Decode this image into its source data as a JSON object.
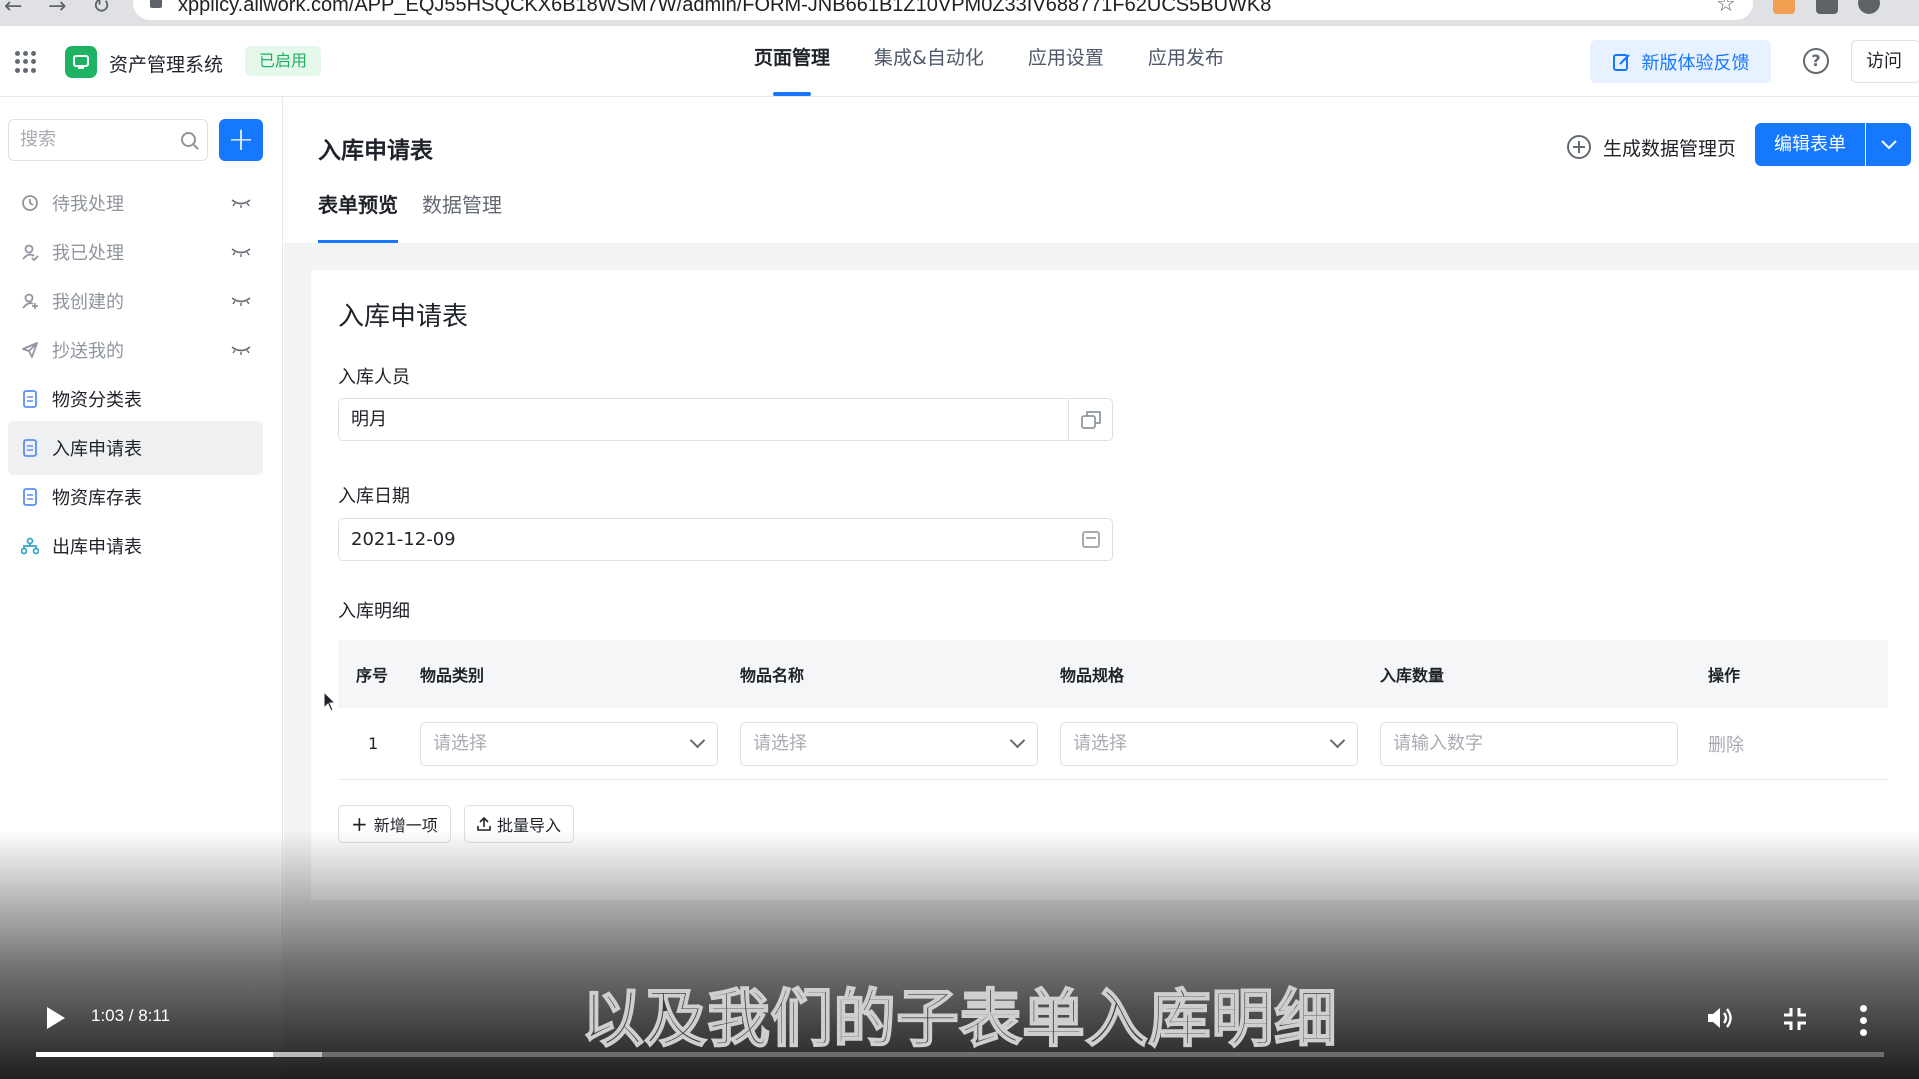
{
  "browser": {
    "url": "xpplicy.aliwork.com/APP_EQJ55HSQCKX6B18WSM7W/admin/FORM-JNB661B1Z10VPM0Z33IV688771F62UCS5BUWK8"
  },
  "header": {
    "app_name": "资产管理系统",
    "status_badge": "已启用",
    "tabs": [
      "页面管理",
      "集成&自动化",
      "应用设置",
      "应用发布"
    ],
    "active_tab": "页面管理",
    "feedback_label": "新版体验反馈",
    "help_glyph": "?",
    "visit_label": "访问"
  },
  "sidebar": {
    "search_placeholder": "搜索",
    "add_glyph": "+",
    "items": [
      {
        "label": "待我处理",
        "icon": "clock-icon",
        "hidden": true
      },
      {
        "label": "我已处理",
        "icon": "user-check-icon",
        "hidden": true
      },
      {
        "label": "我创建的",
        "icon": "user-add-icon",
        "hidden": true
      },
      {
        "label": "抄送我的",
        "icon": "send-icon",
        "hidden": true
      },
      {
        "label": "物资分类表",
        "icon": "document-icon"
      },
      {
        "label": "入库申请表",
        "icon": "document-icon",
        "active": true
      },
      {
        "label": "物资库存表",
        "icon": "document-icon"
      },
      {
        "label": "出库申请表",
        "icon": "flow-icon"
      }
    ]
  },
  "main": {
    "page_title": "入库申请表",
    "generate_label": "生成数据管理页",
    "edit_label": "编辑表单",
    "sub_tabs": [
      "表单预览",
      "数据管理"
    ],
    "active_sub_tab": "表单预览"
  },
  "form": {
    "title": "入库申请表",
    "fields": [
      {
        "label": "入库人员",
        "value": "明月"
      },
      {
        "label": "入库日期",
        "value": "2021-12-09"
      }
    ],
    "detail_label": "入库明细",
    "table": {
      "headers": [
        "序号",
        "物品类别",
        "物品名称",
        "物品规格",
        "入库数量",
        "操作"
      ],
      "rows": [
        {
          "seq": "1",
          "category": "请选择",
          "name": "请选择",
          "spec": "请选择",
          "quantity": "请输入数字",
          "action": "删除"
        }
      ]
    },
    "add_row_label": "新增一项",
    "batch_import_label": "批量导入"
  },
  "video": {
    "subtitle": "以及我们的子表单入库明细",
    "time": "1:03 / 8:11",
    "played_fraction": 0.128,
    "buffered_fraction": 0.155
  },
  "colors": {
    "primary": "#1677ff",
    "brand_green": "#1db362"
  }
}
